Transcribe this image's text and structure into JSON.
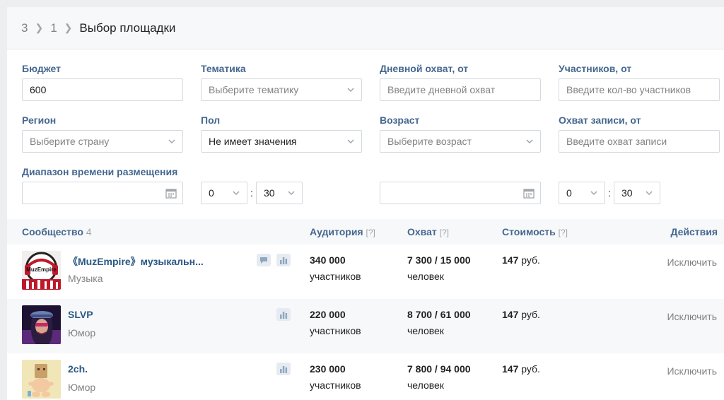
{
  "breadcrumb": {
    "step1": "3",
    "step2": "1",
    "current": "Выбор площадки"
  },
  "filters": {
    "budget": {
      "label": "Бюджет",
      "value": "600"
    },
    "topic": {
      "label": "Тематика",
      "placeholder": "Выберите тематику"
    },
    "daily_reach": {
      "label": "Дневной охват, от",
      "placeholder": "Введите дневной охват"
    },
    "members": {
      "label": "Участников, от",
      "placeholder": "Введите кол-во участников"
    },
    "region": {
      "label": "Регион",
      "placeholder": "Выберите страну"
    },
    "gender": {
      "label": "Пол",
      "value": "Не имеет значения"
    },
    "age": {
      "label": "Возраст",
      "placeholder": "Выберите возраст"
    },
    "post_reach": {
      "label": "Охват записи, от",
      "placeholder": "Введите охват записи"
    },
    "time_range": {
      "label": "Диапазон времени размещения",
      "from_hour": "0",
      "from_min": "30",
      "to_hour": "0",
      "to_min": "30",
      "colon": ":"
    }
  },
  "table": {
    "headers": {
      "community": "Сообщество",
      "community_count": "4",
      "audience": "Аудитория",
      "reach": "Охват",
      "cost": "Стоимость",
      "help": "[?]",
      "actions": "Действия"
    },
    "rows": [
      {
        "name": "《MuzEmpire》музыкальн...",
        "category": "Музыка",
        "audience": "340 000",
        "audience_unit": "участников",
        "reach": "7 300 / 15 000",
        "reach_unit": "человек",
        "price": "147",
        "price_unit": " руб.",
        "action": "Исключить",
        "avatar_text": "MuzEmpire"
      },
      {
        "name": "SLVP",
        "category": "Юмор",
        "audience": "220 000",
        "audience_unit": "участников",
        "reach": "8 700 / 61 000",
        "reach_unit": "человек",
        "price": "147",
        "price_unit": " руб.",
        "action": "Исключить"
      },
      {
        "name": "2ch.",
        "category": "Юмор",
        "audience": "230 000",
        "audience_unit": "участников",
        "reach": "7 800 / 94 000",
        "reach_unit": "человек",
        "price": "147",
        "price_unit": " руб.",
        "action": "Исключить"
      }
    ]
  },
  "colors": {
    "label": "#45678f",
    "link": "#2a5885",
    "muted": "#828282",
    "border": "#d3d9de"
  }
}
